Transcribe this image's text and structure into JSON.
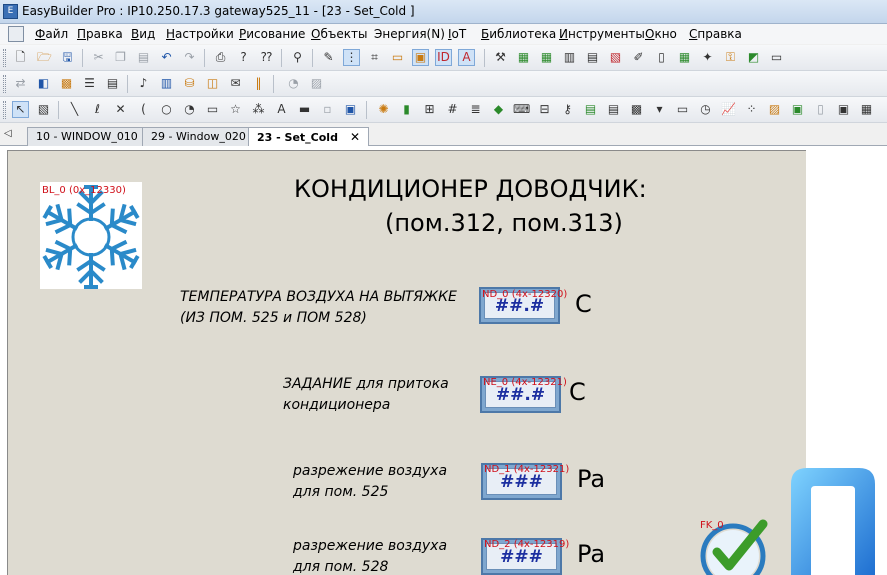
{
  "window": {
    "title": "EasyBuilder Pro : IP10.250.17.3 gateway525_11 - [23 - Set_Cold ]"
  },
  "menu": [
    {
      "key": "Ф",
      "rest": "айл"
    },
    {
      "key": "П",
      "rest": "равка"
    },
    {
      "key": "В",
      "rest": "ид"
    },
    {
      "key": "Н",
      "rest": "астройки"
    },
    {
      "key": "Р",
      "rest": "исование"
    },
    {
      "key": "О",
      "rest": "бъекты"
    },
    {
      "key": "",
      "rest": "Энергия(N)"
    },
    {
      "key": "I",
      "rest": "oT"
    },
    {
      "key": "Б",
      "rest": "иблиотека"
    },
    {
      "key": "И",
      "rest": "нструменты"
    },
    {
      "key": "О",
      "rest": "кно"
    },
    {
      "key": "С",
      "rest": "правка"
    }
  ],
  "tabs": [
    {
      "label": "10 - WINDOW_010",
      "active": false
    },
    {
      "label": "29 - Window_020",
      "active": false
    },
    {
      "label": "23 - Set_Cold",
      "active": true
    }
  ],
  "tab_close": "✕",
  "canvas": {
    "snowflake_id": "BL_0 (0x_12330)",
    "heading_line1": "КОНДИЦИОНЕР ДОВОДЧИК:",
    "heading_line2": "(пом.312, пом.313)",
    "rows": [
      {
        "label1": "ТЕМПЕРАТУРА ВОЗДУХА НА ВЫТЯЖКЕ",
        "label2": "(ИЗ ПОМ. 525 и ПОМ 528)",
        "obj_id": "ND_0 (4x-12320)",
        "format": "##.#",
        "unit": "С"
      },
      {
        "label1": "ЗАДАНИЕ для притока",
        "label2": "кондиционера",
        "obj_id": "NE_0 (4x-12321)",
        "format": "##.#",
        "unit": "С"
      },
      {
        "label1": "разрежение воздуха",
        "label2": "для пом. 525",
        "obj_id": "ND_1 (4x-12321)",
        "format": "###",
        "unit": "Pa"
      },
      {
        "label1": "разрежение воздуха",
        "label2": "для пом. 528",
        "obj_id": "ND_2 (4x-12319)",
        "format": "###",
        "unit": "Pa"
      }
    ],
    "fk_id": "FK_0"
  },
  "icons": {
    "close": "close-icon",
    "snowflake": "snowflake-icon",
    "checkmark": "checkmark-icon",
    "logo": "brand-logo-icon"
  },
  "colors": {
    "canvas_bg": "#dedbd1",
    "object_id": "#d0101a",
    "display_text": "#1c2fa0",
    "snowflake": "#2a8ac9",
    "check": "#3c9c2a"
  }
}
